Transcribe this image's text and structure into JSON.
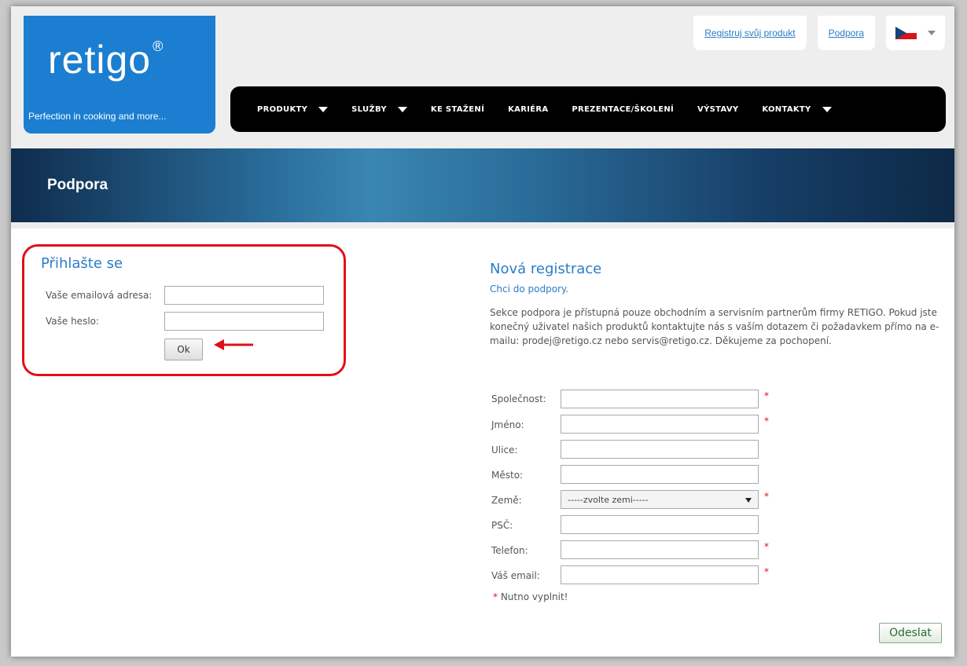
{
  "header": {
    "brand": "retigo",
    "brand_mark": "®",
    "tagline": "Perfection in cooking and more...",
    "top_links": [
      "Registruj svůj produkt",
      "Podpora"
    ],
    "language_flag": "czech-flag-icon"
  },
  "nav": {
    "items": [
      {
        "label": "PRODUKTY",
        "has_dropdown": true
      },
      {
        "label": "SLUŽBY",
        "has_dropdown": true
      },
      {
        "label": "KE STAŽENÍ",
        "has_dropdown": false
      },
      {
        "label": "KARIÉRA",
        "has_dropdown": false
      },
      {
        "label": "PREZENTACE/ŠKOLENÍ",
        "has_dropdown": false
      },
      {
        "label": "VÝSTAVY",
        "has_dropdown": false
      },
      {
        "label": "KONTAKTY",
        "has_dropdown": true
      }
    ]
  },
  "banner": {
    "title": "Podpora"
  },
  "login": {
    "title": "Přihlašte se",
    "email_label": "Vaše emailová adresa:",
    "email_value": "",
    "password_label": "Vaše heslo:",
    "password_value": "",
    "submit_label": "Ok"
  },
  "registration": {
    "title": "Nová registrace",
    "subtitle": "Chci do podpory.",
    "description": "Sekce podpora je přístupná pouze obchodním a servisním partnerům firmy RETIGO. Pokud jste konečný uživatel našich produktů kontaktujte nás s vaším dotazem či požadavkem přímo na e-mailu: prodej@retigo.cz nebo servis@retigo.cz. Děkujeme za pochopení.",
    "fields": [
      {
        "label": "Společnost:",
        "required": true,
        "value": ""
      },
      {
        "label": "Jméno:",
        "required": true,
        "value": ""
      },
      {
        "label": "Ulice:",
        "required": false,
        "value": ""
      },
      {
        "label": "Město:",
        "required": false,
        "value": ""
      },
      {
        "label": "Země:",
        "required": true,
        "value": "-----zvolte zemi-----",
        "type": "select"
      },
      {
        "label": "PSČ:",
        "required": false,
        "value": ""
      },
      {
        "label": "Telefon:",
        "required": true,
        "value": ""
      },
      {
        "label": "Váš email:",
        "required": true,
        "value": ""
      }
    ],
    "required_marker": "*",
    "required_note": "Nutno vyplnit!",
    "submit_label": "Odeslat"
  },
  "colors": {
    "accent": "#2b7cc8",
    "logo_bg": "#1b7ed0",
    "highlight": "#e0101a"
  }
}
